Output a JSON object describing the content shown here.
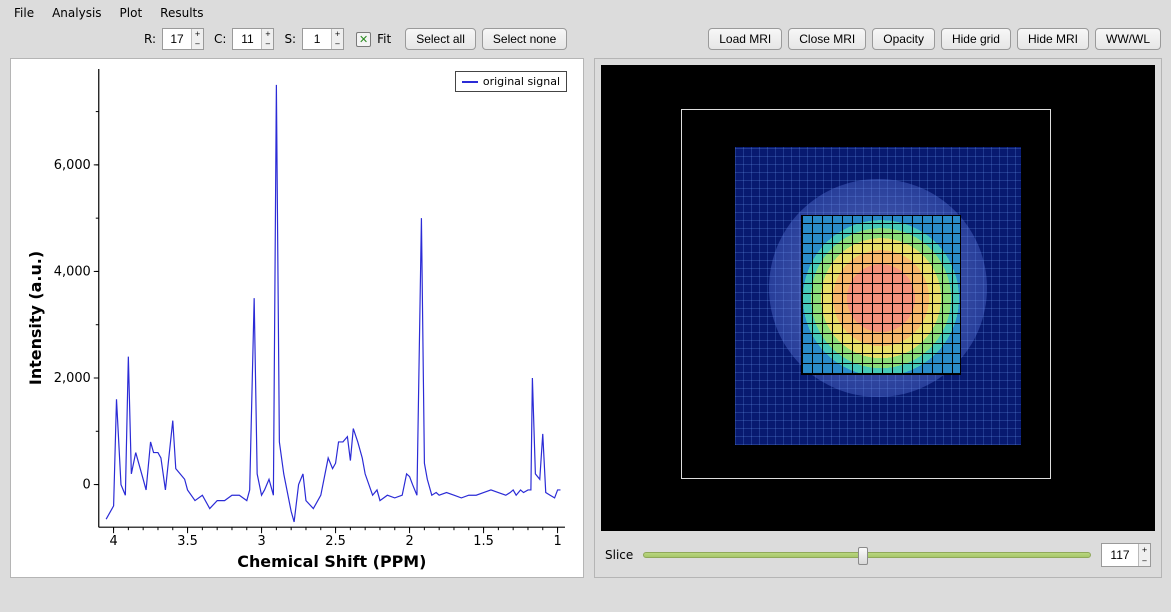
{
  "menu": {
    "file": "File",
    "analysis": "Analysis",
    "plot": "Plot",
    "results": "Results"
  },
  "toolbar": {
    "r_label": "R:",
    "r_value": "17",
    "c_label": "C:",
    "c_value": "11",
    "s_label": "S:",
    "s_value": "1",
    "fit_label": "Fit",
    "select_all": "Select all",
    "select_none": "Select none"
  },
  "mri_toolbar": {
    "load": "Load MRI",
    "close": "Close MRI",
    "opacity": "Opacity",
    "hide_grid": "Hide grid",
    "hide_mri": "Hide MRI",
    "wwwl": "WW/WL"
  },
  "chart": {
    "xlabel": "Chemical Shift (PPM)",
    "ylabel": "Intensity (a.u.)",
    "legend": "original signal",
    "x_ticks": [
      "4",
      "3.5",
      "3",
      "2.5",
      "2",
      "1.5",
      "1"
    ],
    "y_ticks": [
      "0",
      "2,000",
      "4,000",
      "6,000"
    ]
  },
  "slice": {
    "label": "Slice",
    "value": "117"
  },
  "chart_data": {
    "type": "line",
    "title": "",
    "xlabel": "Chemical Shift (PPM)",
    "ylabel": "Intensity (a.u.)",
    "xlim": [
      4.1,
      0.95
    ],
    "ylim": [
      -800,
      7800
    ],
    "series": [
      {
        "name": "original signal",
        "x": [
          4.05,
          4.0,
          3.98,
          3.95,
          3.92,
          3.9,
          3.88,
          3.85,
          3.8,
          3.78,
          3.75,
          3.73,
          3.7,
          3.68,
          3.65,
          3.6,
          3.58,
          3.55,
          3.52,
          3.5,
          3.45,
          3.4,
          3.35,
          3.3,
          3.25,
          3.2,
          3.15,
          3.1,
          3.08,
          3.05,
          3.03,
          3.0,
          2.98,
          2.95,
          2.92,
          2.9,
          2.88,
          2.85,
          2.8,
          2.78,
          2.75,
          2.72,
          2.7,
          2.65,
          2.62,
          2.6,
          2.55,
          2.52,
          2.5,
          2.48,
          2.45,
          2.42,
          2.4,
          2.38,
          2.35,
          2.32,
          2.3,
          2.25,
          2.22,
          2.2,
          2.15,
          2.1,
          2.05,
          2.02,
          2.0,
          1.98,
          1.95,
          1.92,
          1.9,
          1.88,
          1.85,
          1.82,
          1.8,
          1.75,
          1.7,
          1.65,
          1.6,
          1.55,
          1.5,
          1.45,
          1.4,
          1.35,
          1.32,
          1.3,
          1.28,
          1.25,
          1.23,
          1.2,
          1.18,
          1.17,
          1.15,
          1.12,
          1.1,
          1.08,
          1.05,
          1.02,
          1.0,
          0.98
        ],
        "y": [
          -650,
          -400,
          1600,
          0,
          -200,
          2400,
          200,
          600,
          100,
          -100,
          800,
          600,
          600,
          500,
          -100,
          1200,
          300,
          200,
          100,
          -100,
          -300,
          -200,
          -450,
          -300,
          -300,
          -200,
          -200,
          -300,
          -100,
          3500,
          200,
          -200,
          -100,
          100,
          -200,
          7500,
          800,
          200,
          -500,
          -700,
          0,
          200,
          -300,
          -450,
          -300,
          -200,
          500,
          300,
          400,
          800,
          800,
          900,
          450,
          1050,
          800,
          500,
          200,
          -200,
          -100,
          -300,
          -200,
          -250,
          -200,
          200,
          150,
          0,
          -200,
          5000,
          400,
          100,
          -200,
          -150,
          -200,
          -150,
          -200,
          -250,
          -200,
          -200,
          -150,
          -100,
          -150,
          -200,
          -150,
          -100,
          -200,
          -100,
          -150,
          -100,
          -100,
          2000,
          200,
          100,
          950,
          -150,
          -200,
          -250,
          -100,
          -100
        ]
      }
    ]
  }
}
